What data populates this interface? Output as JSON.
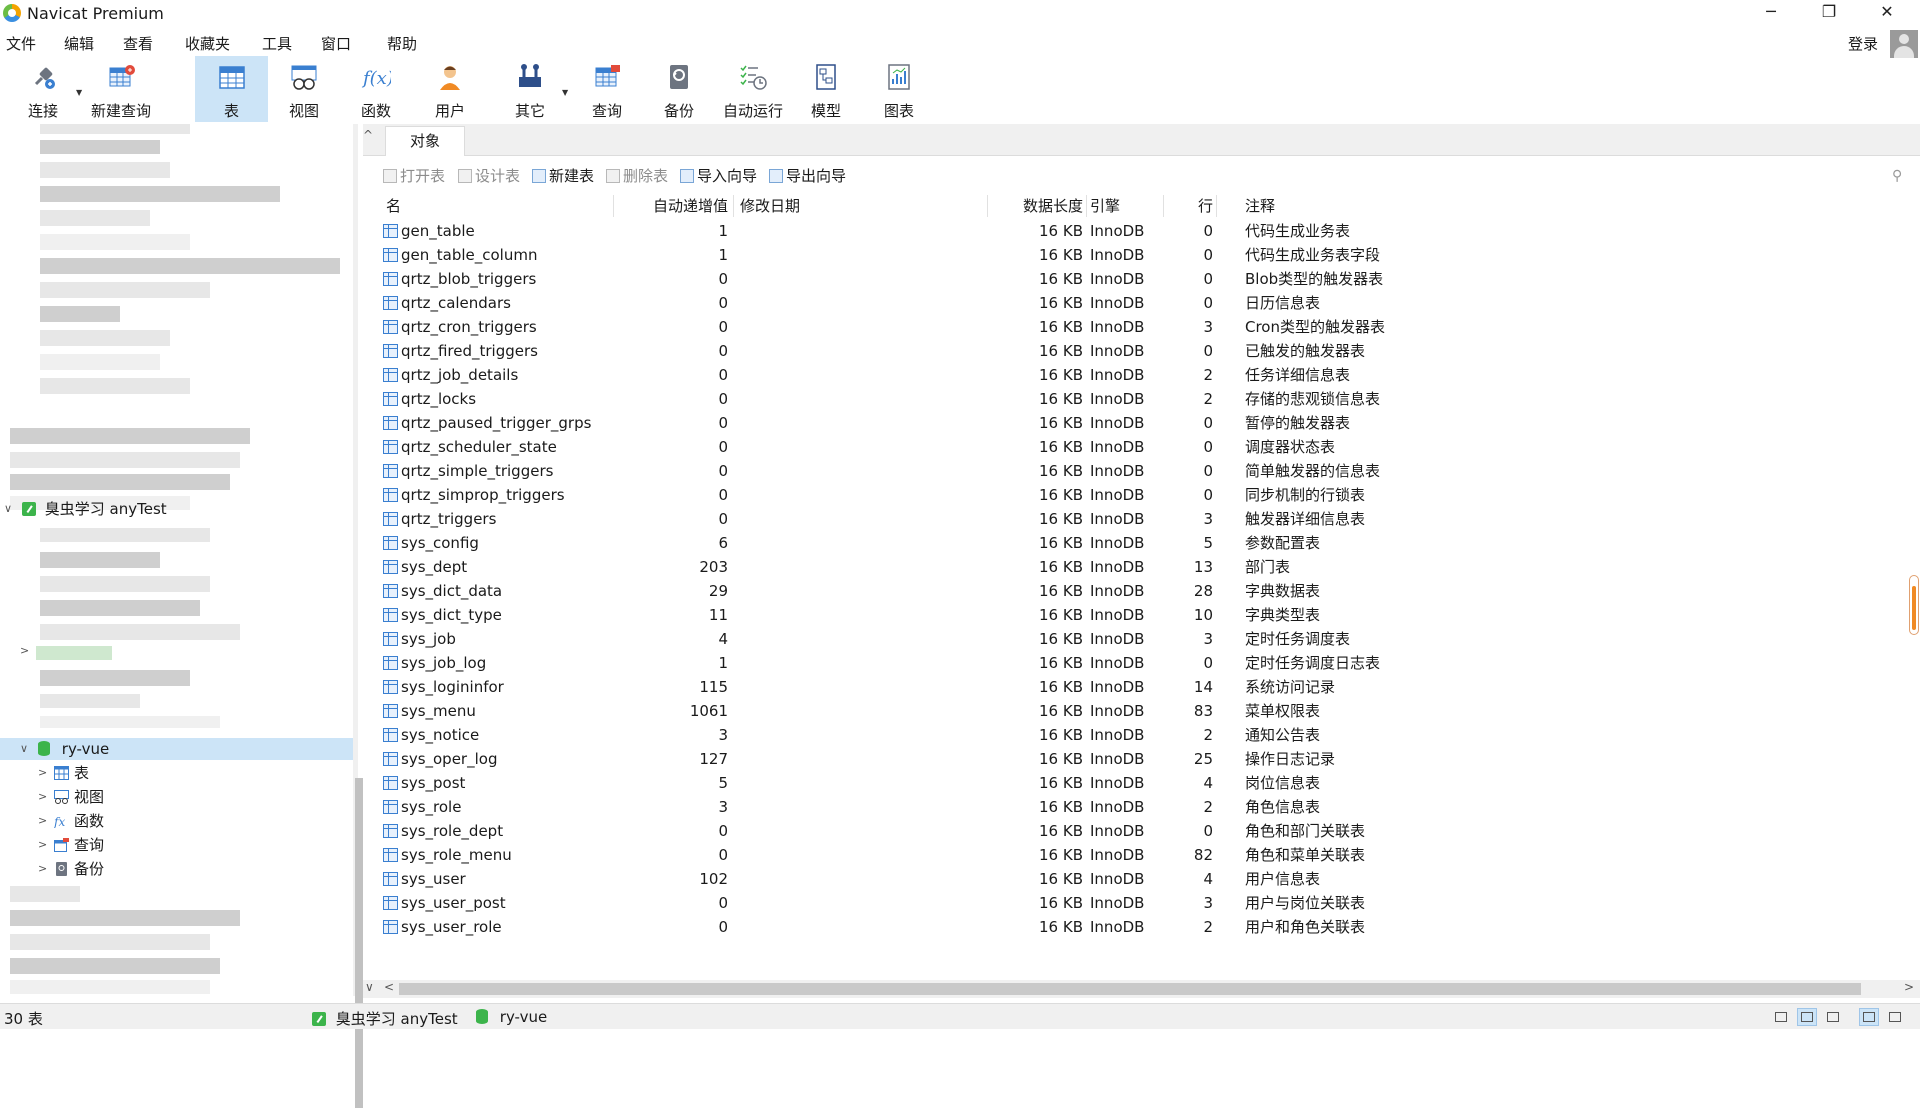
{
  "window": {
    "title": "Navicat Premium",
    "minimize": "─",
    "restore": "❐",
    "close": "✕"
  },
  "menu": [
    "文件",
    "编辑",
    "查看",
    "收藏夹",
    "工具",
    "窗口",
    "帮助"
  ],
  "account": {
    "login": "登录"
  },
  "toolbar": [
    {
      "label": "连接",
      "icon": "plug-icon"
    },
    {
      "label": "新建查询",
      "icon": "new-query-icon"
    },
    {
      "label": "表",
      "icon": "table-icon",
      "active": true
    },
    {
      "label": "视图",
      "icon": "view-icon"
    },
    {
      "label": "函数",
      "icon": "function-icon"
    },
    {
      "label": "用户",
      "icon": "user-icon"
    },
    {
      "label": "其它",
      "icon": "tools-icon"
    },
    {
      "label": "查询",
      "icon": "query-icon"
    },
    {
      "label": "备份",
      "icon": "backup-icon"
    },
    {
      "label": "自动运行",
      "icon": "schedule-icon"
    },
    {
      "label": "模型",
      "icon": "model-icon"
    },
    {
      "label": "图表",
      "icon": "chart-icon"
    }
  ],
  "tree": {
    "connection": "臭虫学习 anyTest",
    "database": "ry-vue",
    "children": [
      "表",
      "视图",
      "函数",
      "查询",
      "备份"
    ]
  },
  "tabs": {
    "objects": "对象"
  },
  "object_toolbar": {
    "open": "打开表",
    "design": "设计表",
    "new": "新建表",
    "delete": "删除表",
    "import": "导入向导",
    "export": "导出向导"
  },
  "table_columns": [
    "名",
    "自动递增值",
    "修改日期",
    "数据长度",
    "引擎",
    "行",
    "注释"
  ],
  "tables": [
    {
      "name": "gen_table",
      "auto_inc": "1",
      "modified": "",
      "size": "16 KB",
      "engine": "InnoDB",
      "rows": "0",
      "comment": "代码生成业务表"
    },
    {
      "name": "gen_table_column",
      "auto_inc": "1",
      "modified": "",
      "size": "16 KB",
      "engine": "InnoDB",
      "rows": "0",
      "comment": "代码生成业务表字段"
    },
    {
      "name": "qrtz_blob_triggers",
      "auto_inc": "0",
      "modified": "",
      "size": "16 KB",
      "engine": "InnoDB",
      "rows": "0",
      "comment": "Blob类型的触发器表"
    },
    {
      "name": "qrtz_calendars",
      "auto_inc": "0",
      "modified": "",
      "size": "16 KB",
      "engine": "InnoDB",
      "rows": "0",
      "comment": "日历信息表"
    },
    {
      "name": "qrtz_cron_triggers",
      "auto_inc": "0",
      "modified": "",
      "size": "16 KB",
      "engine": "InnoDB",
      "rows": "3",
      "comment": "Cron类型的触发器表"
    },
    {
      "name": "qrtz_fired_triggers",
      "auto_inc": "0",
      "modified": "",
      "size": "16 KB",
      "engine": "InnoDB",
      "rows": "0",
      "comment": "已触发的触发器表"
    },
    {
      "name": "qrtz_job_details",
      "auto_inc": "0",
      "modified": "",
      "size": "16 KB",
      "engine": "InnoDB",
      "rows": "2",
      "comment": "任务详细信息表"
    },
    {
      "name": "qrtz_locks",
      "auto_inc": "0",
      "modified": "",
      "size": "16 KB",
      "engine": "InnoDB",
      "rows": "2",
      "comment": "存储的悲观锁信息表"
    },
    {
      "name": "qrtz_paused_trigger_grps",
      "auto_inc": "0",
      "modified": "",
      "size": "16 KB",
      "engine": "InnoDB",
      "rows": "0",
      "comment": "暂停的触发器表"
    },
    {
      "name": "qrtz_scheduler_state",
      "auto_inc": "0",
      "modified": "",
      "size": "16 KB",
      "engine": "InnoDB",
      "rows": "0",
      "comment": "调度器状态表"
    },
    {
      "name": "qrtz_simple_triggers",
      "auto_inc": "0",
      "modified": "",
      "size": "16 KB",
      "engine": "InnoDB",
      "rows": "0",
      "comment": "简单触发器的信息表"
    },
    {
      "name": "qrtz_simprop_triggers",
      "auto_inc": "0",
      "modified": "",
      "size": "16 KB",
      "engine": "InnoDB",
      "rows": "0",
      "comment": "同步机制的行锁表"
    },
    {
      "name": "qrtz_triggers",
      "auto_inc": "0",
      "modified": "",
      "size": "16 KB",
      "engine": "InnoDB",
      "rows": "3",
      "comment": "触发器详细信息表"
    },
    {
      "name": "sys_config",
      "auto_inc": "6",
      "modified": "",
      "size": "16 KB",
      "engine": "InnoDB",
      "rows": "5",
      "comment": "参数配置表"
    },
    {
      "name": "sys_dept",
      "auto_inc": "203",
      "modified": "",
      "size": "16 KB",
      "engine": "InnoDB",
      "rows": "13",
      "comment": "部门表"
    },
    {
      "name": "sys_dict_data",
      "auto_inc": "29",
      "modified": "",
      "size": "16 KB",
      "engine": "InnoDB",
      "rows": "28",
      "comment": "字典数据表"
    },
    {
      "name": "sys_dict_type",
      "auto_inc": "11",
      "modified": "",
      "size": "16 KB",
      "engine": "InnoDB",
      "rows": "10",
      "comment": "字典类型表"
    },
    {
      "name": "sys_job",
      "auto_inc": "4",
      "modified": "",
      "size": "16 KB",
      "engine": "InnoDB",
      "rows": "3",
      "comment": "定时任务调度表"
    },
    {
      "name": "sys_job_log",
      "auto_inc": "1",
      "modified": "",
      "size": "16 KB",
      "engine": "InnoDB",
      "rows": "0",
      "comment": "定时任务调度日志表"
    },
    {
      "name": "sys_logininfor",
      "auto_inc": "115",
      "modified": "",
      "size": "16 KB",
      "engine": "InnoDB",
      "rows": "14",
      "comment": "系统访问记录"
    },
    {
      "name": "sys_menu",
      "auto_inc": "1061",
      "modified": "",
      "size": "16 KB",
      "engine": "InnoDB",
      "rows": "83",
      "comment": "菜单权限表"
    },
    {
      "name": "sys_notice",
      "auto_inc": "3",
      "modified": "",
      "size": "16 KB",
      "engine": "InnoDB",
      "rows": "2",
      "comment": "通知公告表"
    },
    {
      "name": "sys_oper_log",
      "auto_inc": "127",
      "modified": "",
      "size": "16 KB",
      "engine": "InnoDB",
      "rows": "25",
      "comment": "操作日志记录"
    },
    {
      "name": "sys_post",
      "auto_inc": "5",
      "modified": "",
      "size": "16 KB",
      "engine": "InnoDB",
      "rows": "4",
      "comment": "岗位信息表"
    },
    {
      "name": "sys_role",
      "auto_inc": "3",
      "modified": "",
      "size": "16 KB",
      "engine": "InnoDB",
      "rows": "2",
      "comment": "角色信息表"
    },
    {
      "name": "sys_role_dept",
      "auto_inc": "0",
      "modified": "",
      "size": "16 KB",
      "engine": "InnoDB",
      "rows": "0",
      "comment": "角色和部门关联表"
    },
    {
      "name": "sys_role_menu",
      "auto_inc": "0",
      "modified": "",
      "size": "16 KB",
      "engine": "InnoDB",
      "rows": "82",
      "comment": "角色和菜单关联表"
    },
    {
      "name": "sys_user",
      "auto_inc": "102",
      "modified": "",
      "size": "16 KB",
      "engine": "InnoDB",
      "rows": "4",
      "comment": "用户信息表"
    },
    {
      "name": "sys_user_post",
      "auto_inc": "0",
      "modified": "",
      "size": "16 KB",
      "engine": "InnoDB",
      "rows": "3",
      "comment": "用户与岗位关联表"
    },
    {
      "name": "sys_user_role",
      "auto_inc": "0",
      "modified": "",
      "size": "16 KB",
      "engine": "InnoDB",
      "rows": "2",
      "comment": "用户和角色关联表"
    }
  ],
  "status": {
    "count": "30 表",
    "connection": "臭虫学习 anyTest",
    "database": "ry-vue"
  },
  "colors": {
    "selection": "#cce4f7",
    "accent": "#3a7fd0",
    "conn_green": "#3cb44b",
    "scroll_orange": "#f08a24"
  }
}
